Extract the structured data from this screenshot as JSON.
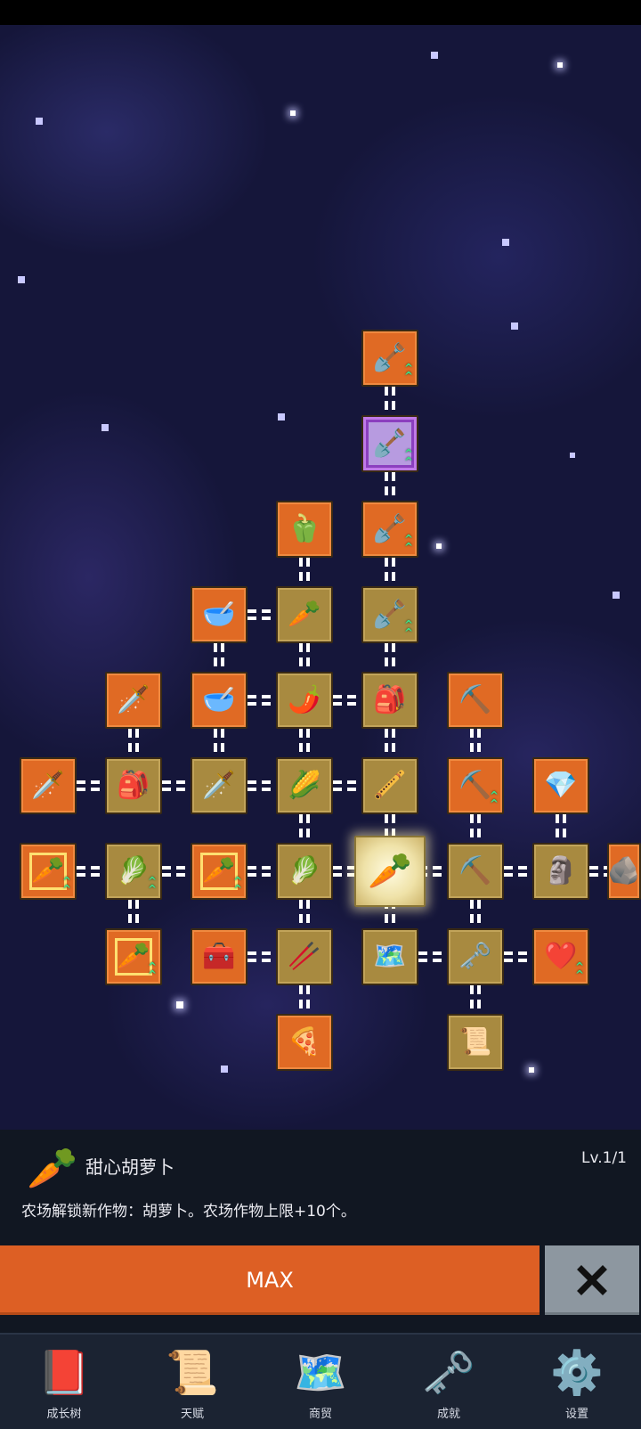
{
  "skill_tree": {
    "nodes": [
      {
        "id": "n-shovel-top",
        "color": "orange",
        "icon": "🪏",
        "icon_name": "shovel-icon",
        "upgrade": true
      },
      {
        "id": "n-shovel-magic",
        "color": "purple",
        "icon": "🪏",
        "icon_name": "magic-shovel-icon",
        "upgrade": true
      },
      {
        "id": "n-pepper",
        "color": "orange",
        "icon": "🫑",
        "icon_name": "pepper-icon",
        "upgrade": false
      },
      {
        "id": "n-shovel-3",
        "color": "orange",
        "icon": "🪏",
        "icon_name": "shovel-icon",
        "upgrade": true
      },
      {
        "id": "n-bowl-1",
        "color": "orange",
        "icon": "🥣",
        "icon_name": "bowl-icon",
        "upgrade": false
      },
      {
        "id": "n-radish",
        "color": "gold",
        "icon": "🥕",
        "icon_name": "radish-icon",
        "upgrade": false
      },
      {
        "id": "n-shovel-4",
        "color": "gold",
        "icon": "🪏",
        "icon_name": "shovel-icon",
        "upgrade": true
      },
      {
        "id": "n-sword-gold",
        "color": "orange",
        "icon": "🗡️",
        "icon_name": "gold-sword-icon",
        "upgrade": false
      },
      {
        "id": "n-bowl-2",
        "color": "orange",
        "icon": "🥣",
        "icon_name": "bowl-icon",
        "upgrade": false
      },
      {
        "id": "n-chili",
        "color": "gold",
        "icon": "🌶️",
        "icon_name": "chili-icon",
        "upgrade": false
      },
      {
        "id": "n-backpack-1",
        "color": "gold",
        "icon": "🎒",
        "icon_name": "backpack-icon",
        "upgrade": false
      },
      {
        "id": "n-pickaxe-green",
        "color": "orange",
        "icon": "⛏️",
        "icon_name": "pickaxe-icon",
        "upgrade": false
      },
      {
        "id": "n-sword-stone",
        "color": "orange",
        "icon": "🗡️",
        "icon_name": "sword-icon",
        "upgrade": false
      },
      {
        "id": "n-backpack-2",
        "color": "gold",
        "icon": "🎒",
        "icon_name": "backpack-icon",
        "upgrade": false
      },
      {
        "id": "n-sword-2",
        "color": "gold",
        "icon": "🗡️",
        "icon_name": "sword-icon",
        "upgrade": false
      },
      {
        "id": "n-corn",
        "color": "gold",
        "icon": "🌽",
        "icon_name": "corn-icon",
        "upgrade": false
      },
      {
        "id": "n-flute",
        "color": "gold",
        "icon": "🪈",
        "icon_name": "flute-icon",
        "upgrade": false
      },
      {
        "id": "n-pickaxe-2",
        "color": "orange",
        "icon": "⛏️",
        "icon_name": "pickaxe-icon",
        "upgrade": true
      },
      {
        "id": "n-crystal",
        "color": "orange",
        "icon": "💎",
        "icon_name": "crystal-icon",
        "upgrade": false
      },
      {
        "id": "n-carrot-1",
        "color": "orange",
        "icon": "🥕",
        "icon_name": "carrot-icon",
        "upgrade": true,
        "framed": true
      },
      {
        "id": "n-cabbage-1",
        "color": "gold",
        "icon": "🥬",
        "icon_name": "cabbage-icon",
        "upgrade": true
      },
      {
        "id": "n-carrot-2",
        "color": "orange",
        "icon": "🥕",
        "icon_name": "carrot-icon",
        "upgrade": true,
        "framed": true
      },
      {
        "id": "n-cabbage-2",
        "color": "gold",
        "icon": "🥬",
        "icon_name": "cabbage-icon",
        "upgrade": false
      },
      {
        "id": "n-sweet-carrot",
        "color": "selected",
        "icon": "🥕",
        "icon_name": "sweet-carrot-icon",
        "upgrade": false
      },
      {
        "id": "n-pickaxe-3",
        "color": "gold",
        "icon": "⛏️",
        "icon_name": "pickaxe-icon",
        "upgrade": false
      },
      {
        "id": "n-statue",
        "color": "gold",
        "icon": "🗿",
        "icon_name": "statue-icon",
        "upgrade": false
      },
      {
        "id": "n-edge",
        "color": "orange",
        "icon": "🪨",
        "icon_name": "partial-node-icon",
        "upgrade": false
      },
      {
        "id": "n-carrot-3",
        "color": "orange",
        "icon": "🥕",
        "icon_name": "carrot-icon",
        "upgrade": true,
        "framed": true
      },
      {
        "id": "n-chest",
        "color": "orange",
        "icon": "🧰",
        "icon_name": "treasure-chest-icon",
        "upgrade": false
      },
      {
        "id": "n-parsnip",
        "color": "gold",
        "icon": "🥢",
        "icon_name": "parsnip-icon",
        "upgrade": false
      },
      {
        "id": "n-map",
        "color": "gold",
        "icon": "🗺️",
        "icon_name": "map-icon",
        "upgrade": false
      },
      {
        "id": "n-key",
        "color": "gold",
        "icon": "🗝️",
        "icon_name": "key-icon",
        "upgrade": false
      },
      {
        "id": "n-heart",
        "color": "orange",
        "icon": "❤️",
        "icon_name": "heart-icon",
        "upgrade": true
      },
      {
        "id": "n-pizza",
        "color": "orange",
        "icon": "🍕",
        "icon_name": "pizza-icon",
        "upgrade": false
      },
      {
        "id": "n-scroll",
        "color": "gold",
        "icon": "📜",
        "icon_name": "scroll-icon",
        "upgrade": false
      }
    ]
  },
  "info_panel": {
    "icon": "🥕",
    "title": "甜心胡萝卜",
    "level": "Lv.1/1",
    "description": "农场解锁新作物：胡萝卜。农场作物上限+10个。"
  },
  "actions": {
    "max_label": "MAX"
  },
  "bottom_nav": {
    "items": [
      {
        "label": "成长树",
        "icon": "📕",
        "icon_name": "book-icon"
      },
      {
        "label": "天赋",
        "icon": "📜",
        "icon_name": "scroll-icon"
      },
      {
        "label": "商贸",
        "icon": "🗺️",
        "icon_name": "map-icon"
      },
      {
        "label": "成就",
        "icon": "🗝️",
        "icon_name": "key-icon"
      },
      {
        "label": "设置",
        "icon": "⚙️",
        "icon_name": "gear-icon"
      }
    ]
  },
  "colors": {
    "orange_node": "#e06a24",
    "gold_node": "#a88a40",
    "purple_node": "#8b3fbf",
    "max_button": "#dd5f24",
    "close_button": "#8d97a0",
    "panel_bg": "#111722",
    "nav_bg": "#1b2332"
  }
}
